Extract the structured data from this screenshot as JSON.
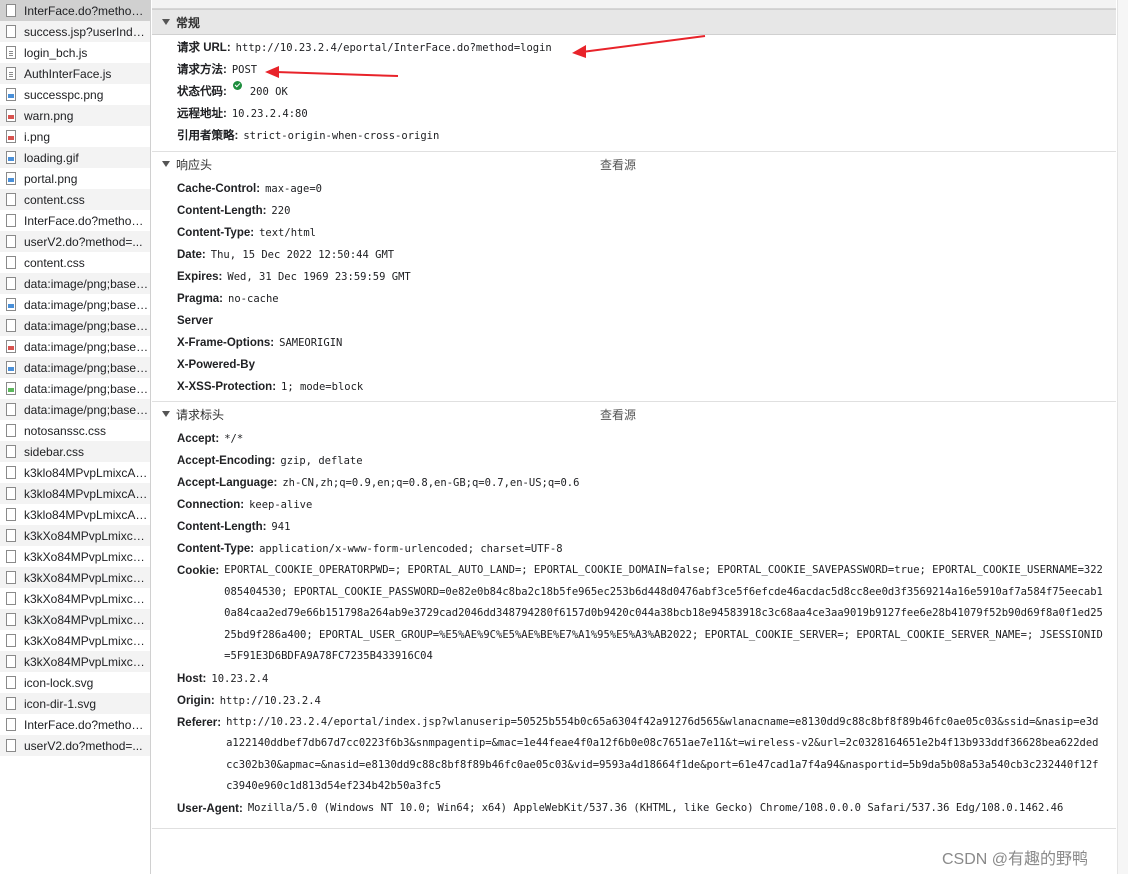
{
  "files": [
    {
      "name": "InterFace.do?method=login",
      "icon": "file-icon",
      "selected": true
    },
    {
      "name": "success.jsp?userIndex=...",
      "icon": "file-icon"
    },
    {
      "name": "login_bch.js",
      "icon": "script-file-icon"
    },
    {
      "name": "AuthInterFace.js",
      "icon": "script-file-icon"
    },
    {
      "name": "successpc.png",
      "icon": "image-file-icon"
    },
    {
      "name": "warn.png",
      "icon": "image-file-icon-red"
    },
    {
      "name": "i.png",
      "icon": "image-file-icon-red"
    },
    {
      "name": "loading.gif",
      "icon": "image-file-icon"
    },
    {
      "name": "portal.png",
      "icon": "image-file-icon"
    },
    {
      "name": "content.css",
      "icon": "file-icon"
    },
    {
      "name": "InterFace.do?method=...",
      "icon": "file-icon"
    },
    {
      "name": "userV2.do?method=...",
      "icon": "file-icon"
    },
    {
      "name": "content.css",
      "icon": "file-icon"
    },
    {
      "name": "data:image/png;base64...",
      "icon": "file-icon"
    },
    {
      "name": "data:image/png;base64...",
      "icon": "image-file-icon"
    },
    {
      "name": "data:image/png;base64...",
      "icon": "file-icon"
    },
    {
      "name": "data:image/png;base64...",
      "icon": "image-file-icon-red"
    },
    {
      "name": "data:image/png;base64...",
      "icon": "image-file-icon"
    },
    {
      "name": "data:image/png;base64...",
      "icon": "image-file-icon-green"
    },
    {
      "name": "data:image/png;base64...",
      "icon": "file-icon"
    },
    {
      "name": "notosanssc.css",
      "icon": "file-icon"
    },
    {
      "name": "sidebar.css",
      "icon": "file-icon"
    },
    {
      "name": "k3klo84MPvpLmixcAOX...",
      "icon": "file-icon"
    },
    {
      "name": "k3klo84MPvpLmixcAOX...",
      "icon": "file-icon"
    },
    {
      "name": "k3klo84MPvpLmixcAOX...",
      "icon": "file-icon"
    },
    {
      "name": "k3kXo84MPvpLmixcAO...",
      "icon": "file-icon"
    },
    {
      "name": "k3kXo84MPvpLmixcAO...",
      "icon": "file-icon"
    },
    {
      "name": "k3kXo84MPvpLmixcAO...",
      "icon": "file-icon"
    },
    {
      "name": "k3kXo84MPvpLmixcAO...",
      "icon": "file-icon"
    },
    {
      "name": "k3kXo84MPvpLmixcAO...",
      "icon": "file-icon"
    },
    {
      "name": "k3kXo84MPvpLmixcAO...",
      "icon": "file-icon"
    },
    {
      "name": "k3kXo84MPvpLmixcAO...",
      "icon": "file-icon"
    },
    {
      "name": "icon-lock.svg",
      "icon": "file-icon"
    },
    {
      "name": "icon-dir-1.svg",
      "icon": "file-icon"
    },
    {
      "name": "InterFace.do?method=...",
      "icon": "file-icon"
    },
    {
      "name": "userV2.do?method=...",
      "icon": "file-icon"
    }
  ],
  "general": {
    "title": "常规",
    "rows": [
      {
        "k": "请求 URL:",
        "v": "http://10.23.2.4/eportal/InterFace.do?method=login"
      },
      {
        "k": "请求方法:",
        "v": "POST"
      },
      {
        "k": "状态代码:",
        "v": "200 OK",
        "status_icon": "check-circle-icon"
      },
      {
        "k": "远程地址:",
        "v": "10.23.2.4:80"
      },
      {
        "k": "引用者策略:",
        "v": "strict-origin-when-cross-origin"
      }
    ]
  },
  "response_headers": {
    "title": "响应头",
    "view_source": "查看源",
    "rows": [
      {
        "k": "Cache-Control:",
        "v": "max-age=0"
      },
      {
        "k": "Content-Length:",
        "v": "220"
      },
      {
        "k": "Content-Type:",
        "v": "text/html"
      },
      {
        "k": "Date:",
        "v": "Thu, 15 Dec 2022 12:50:44 GMT"
      },
      {
        "k": "Expires:",
        "v": "Wed, 31 Dec 1969 23:59:59 GMT"
      },
      {
        "k": "Pragma:",
        "v": "no-cache"
      },
      {
        "k": "Server",
        "v": ""
      },
      {
        "k": "X-Frame-Options:",
        "v": "SAMEORIGIN"
      },
      {
        "k": "X-Powered-By",
        "v": ""
      },
      {
        "k": "X-XSS-Protection:",
        "v": "1; mode=block"
      }
    ]
  },
  "request_headers": {
    "title": "请求标头",
    "view_source": "查看源",
    "rows": [
      {
        "k": "Accept:",
        "v": "*/*"
      },
      {
        "k": "Accept-Encoding:",
        "v": "gzip, deflate"
      },
      {
        "k": "Accept-Language:",
        "v": "zh-CN,zh;q=0.9,en;q=0.8,en-GB;q=0.7,en-US;q=0.6"
      },
      {
        "k": "Connection:",
        "v": "keep-alive"
      },
      {
        "k": "Content-Length:",
        "v": "941"
      },
      {
        "k": "Content-Type:",
        "v": "application/x-www-form-urlencoded; charset=UTF-8"
      },
      {
        "k": "Cookie:",
        "v": "EPORTAL_COOKIE_OPERATORPWD=; EPORTAL_AUTO_LAND=; EPORTAL_COOKIE_DOMAIN=false; EPORTAL_COOKIE_SAVEPASSWORD=true; EPORTAL_COOKIE_USERNAME=322085404530; EPORTAL_COOKIE_PASSWORD=0e82e0b84c8ba2c18b5fe965ec253b6d448d0476abf3ce5f6efcde46acdac5d8cc8ee0d3f3569214a16e5910af7a584f75eecab10a84caa2ed79e66b151798a264ab9e3729cad2046dd348794280f6157d0b9420c044a38bcb18e94583918c3c68aa4ce3aa9019b9127fee6e28b41079f52b90d69f8a0f1ed2525bd9f286a400; EPORTAL_USER_GROUP=%E5%AE%9C%E5%AE%BE%E7%A1%95%E5%A3%AB2022; EPORTAL_COOKIE_SERVER=; EPORTAL_COOKIE_SERVER_NAME=; JSESSIONID=5F91E3D6BDFA9A78FC7235B433916C04",
        "wrap": true
      },
      {
        "k": "Host:",
        "v": "10.23.2.4"
      },
      {
        "k": "Origin:",
        "v": "http://10.23.2.4"
      },
      {
        "k": "Referer:",
        "v": "http://10.23.2.4/eportal/index.jsp?wlanuserip=50525b554b0c65a6304f42a91276d565&wlanacname=e8130dd9c88c8bf8f89b46fc0ae05c03&ssid=&nasip=e3da122140ddbef7db67d7cc0223f6b3&snmpagentip=&mac=1e44feae4f0a12f6b0e08c7651ae7e11&t=wireless-v2&url=2c0328164651e2b4f13b933ddf36628bea622dedcc302b30&apmac=&nasid=e8130dd9c88c8bf8f89b46fc0ae05c03&vid=9593a4d18664f1de&port=61e47cad1a7f4a94&nasportid=5b9da5b08a53a540cb3c232440f12fc3940e960c1d813d54ef234b42b50a3fc5",
        "wrap": true
      },
      {
        "k": "User-Agent:",
        "v": "Mozilla/5.0 (Windows NT 10.0; Win64; x64) AppleWebKit/537.36 (KHTML, like Gecko) Chrome/108.0.0.0 Safari/537.36 Edg/108.0.1462.46",
        "wrap": true
      }
    ]
  },
  "watermark": "CSDN @有趣的野鸭",
  "colors": {
    "arrow": "#e8232a",
    "status_ok": "#1e8e3e",
    "header_bg": "#e7e7e7",
    "selected_row": "#d0d0d0"
  }
}
